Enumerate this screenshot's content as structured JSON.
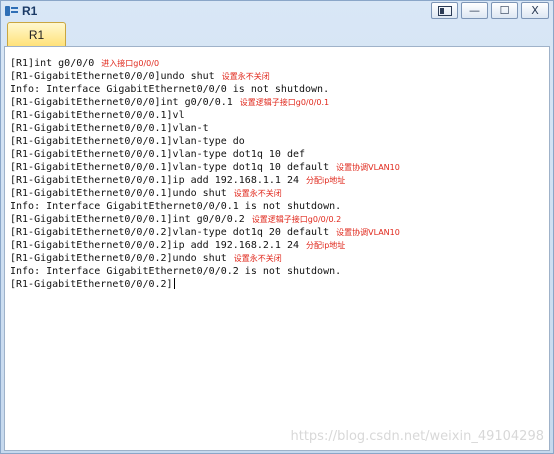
{
  "window": {
    "title": "R1",
    "controls": [
      "restore-panel-icon",
      "minimize-icon",
      "maximize-icon",
      "close-icon"
    ],
    "minimize_glyph": "—",
    "maximize_glyph": "☐",
    "close_glyph": "X"
  },
  "tabs": [
    {
      "label": "R1",
      "active": true
    }
  ],
  "terminal": {
    "lines": [
      {
        "text": "[R1]int g0/0/0",
        "note": "进入接口g0/0/0"
      },
      {
        "text": "[R1-GigabitEthernet0/0/0]undo shut",
        "note": "设置永不关闭"
      },
      {
        "text": "Info: Interface GigabitEthernet0/0/0 is not shutdown.",
        "note": ""
      },
      {
        "text": "[R1-GigabitEthernet0/0/0]int g0/0/0.1",
        "note": "设置逻辑子接口g0/0/0.1"
      },
      {
        "text": "[R1-GigabitEthernet0/0/0.1]vl",
        "note": ""
      },
      {
        "text": "[R1-GigabitEthernet0/0/0.1]vlan-t",
        "note": ""
      },
      {
        "text": "[R1-GigabitEthernet0/0/0.1]vlan-type do",
        "note": ""
      },
      {
        "text": "[R1-GigabitEthernet0/0/0.1]vlan-type dot1q 10 def",
        "note": ""
      },
      {
        "text": "[R1-GigabitEthernet0/0/0.1]vlan-type dot1q 10 default",
        "note": "设置协调VLAN10"
      },
      {
        "text": "[R1-GigabitEthernet0/0/0.1]ip add 192.168.1.1 24",
        "note": "分配ip地址"
      },
      {
        "text": "[R1-GigabitEthernet0/0/0.1]undo shut",
        "note": "设置永不关闭"
      },
      {
        "text": "Info: Interface GigabitEthernet0/0/0.1 is not shutdown.",
        "note": ""
      },
      {
        "text": "[R1-GigabitEthernet0/0/0.1]int g0/0/0.2",
        "note": "设置逻辑子接口g0/0/0.2"
      },
      {
        "text": "[R1-GigabitEthernet0/0/0.2]vlan-type dot1q 20 default",
        "note": "设置协调VLAN10"
      },
      {
        "text": "[R1-GigabitEthernet0/0/0.2]ip add 192.168.2.1 24",
        "note": "分配ip地址"
      },
      {
        "text": "[R1-GigabitEthernet0/0/0.2]undo shut",
        "note": "设置永不关闭"
      },
      {
        "text": "Info: Interface GigabitEthernet0/0/0.2 is not shutdown.",
        "note": ""
      },
      {
        "text": "[R1-GigabitEthernet0/0/0.2]",
        "note": "",
        "cursor": true
      }
    ]
  },
  "watermark": "https://blog.csdn.net/weixin_49104298",
  "colors": {
    "note_text": "#e0281c",
    "tab_active": "#ffe27a",
    "title_bar": "#d9e7f6"
  }
}
